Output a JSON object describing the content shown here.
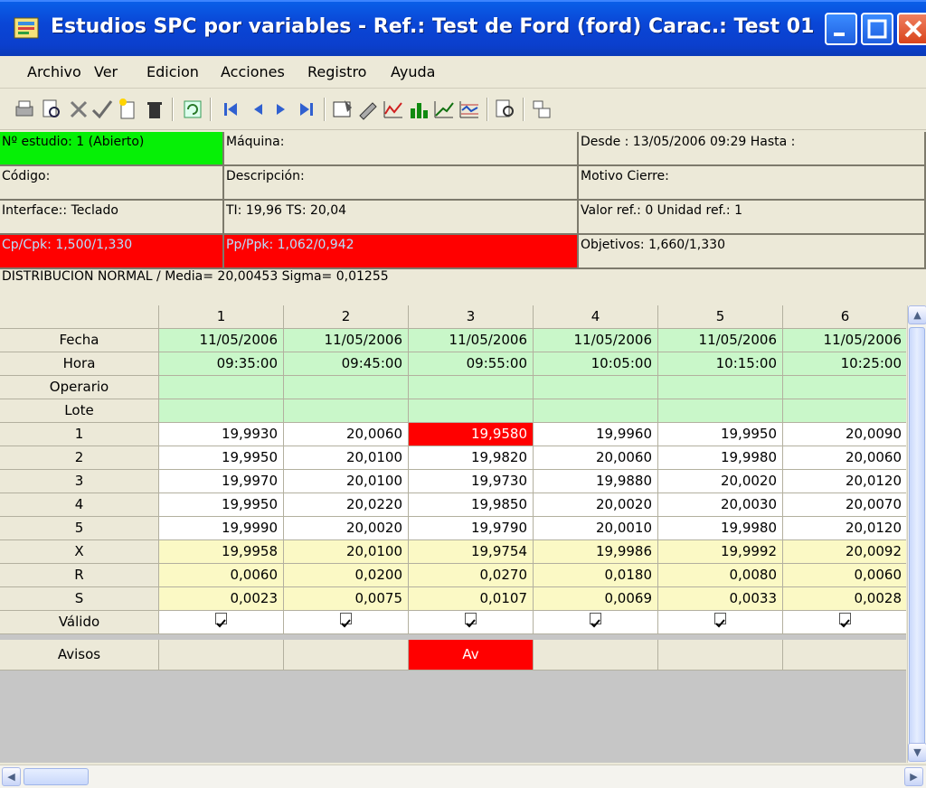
{
  "window": {
    "title": "Estudios SPC por variables  -  Ref.: Test de Ford (ford)  Carac.: Test 01"
  },
  "menu": [
    "Archivo",
    "Ver",
    "Edicion",
    "Acciones",
    "Registro",
    "Ayuda"
  ],
  "info": {
    "estudio": "Nº estudio: 1 (Abierto)",
    "maquina": "Máquina:",
    "desde": "Desde : 13/05/2006 09:29 Hasta :",
    "codigo": "Código:",
    "descripcion": "Descripción:",
    "motivo": "Motivo Cierre:",
    "interface": "Interface:: Teclado",
    "tolerancias": "TI: 19,96 TS: 20,04",
    "valor_ref": "Valor ref.: 0 Unidad ref.: 1",
    "cp_cpk": "Cp/Cpk: 1,500/1,330",
    "pp_ppk": "Pp/Ppk: 1,062/0,942",
    "objetivos": "Objetivos: 1,660/1,330",
    "distribucion": "DISTRIBUCION NORMAL / Media= 20,00453 Sigma= 0,01255"
  },
  "table": {
    "columns": [
      "1",
      "2",
      "3",
      "4",
      "5",
      "6"
    ],
    "row_labels": [
      "Fecha",
      "Hora",
      "Operario",
      "Lote",
      "1",
      "2",
      "3",
      "4",
      "5",
      "X",
      "R",
      "S",
      "Válido",
      "Avisos"
    ],
    "fecha": [
      "11/05/2006",
      "11/05/2006",
      "11/05/2006",
      "11/05/2006",
      "11/05/2006",
      "11/05/2006"
    ],
    "hora": [
      "09:35:00",
      "09:45:00",
      "09:55:00",
      "10:05:00",
      "10:15:00",
      "10:25:00"
    ],
    "m1": [
      "19,9930",
      "20,0060",
      "19,9580",
      "19,9960",
      "19,9950",
      "20,0090"
    ],
    "m2": [
      "19,9950",
      "20,0100",
      "19,9820",
      "20,0060",
      "19,9980",
      "20,0060"
    ],
    "m3": [
      "19,9970",
      "20,0100",
      "19,9730",
      "19,9880",
      "20,0020",
      "20,0120"
    ],
    "m4": [
      "19,9950",
      "20,0220",
      "19,9850",
      "20,0020",
      "20,0030",
      "20,0070"
    ],
    "m5": [
      "19,9990",
      "20,0020",
      "19,9790",
      "20,0010",
      "19,9980",
      "20,0120"
    ],
    "x": [
      "19,9958",
      "20,0100",
      "19,9754",
      "19,9986",
      "19,9992",
      "20,0092"
    ],
    "r": [
      "0,0060",
      "0,0200",
      "0,0270",
      "0,0180",
      "0,0080",
      "0,0060"
    ],
    "s": [
      "0,0023",
      "0,0075",
      "0,0107",
      "0,0069",
      "0,0033",
      "0,0028"
    ],
    "avisos": [
      "",
      "",
      "Av",
      "",
      "",
      ""
    ]
  },
  "colors": {
    "ok_green": "#06f006",
    "alarm_red": "#ff0000",
    "data_green": "#c9f7c9",
    "stats_yellow": "#fbf9c5"
  }
}
